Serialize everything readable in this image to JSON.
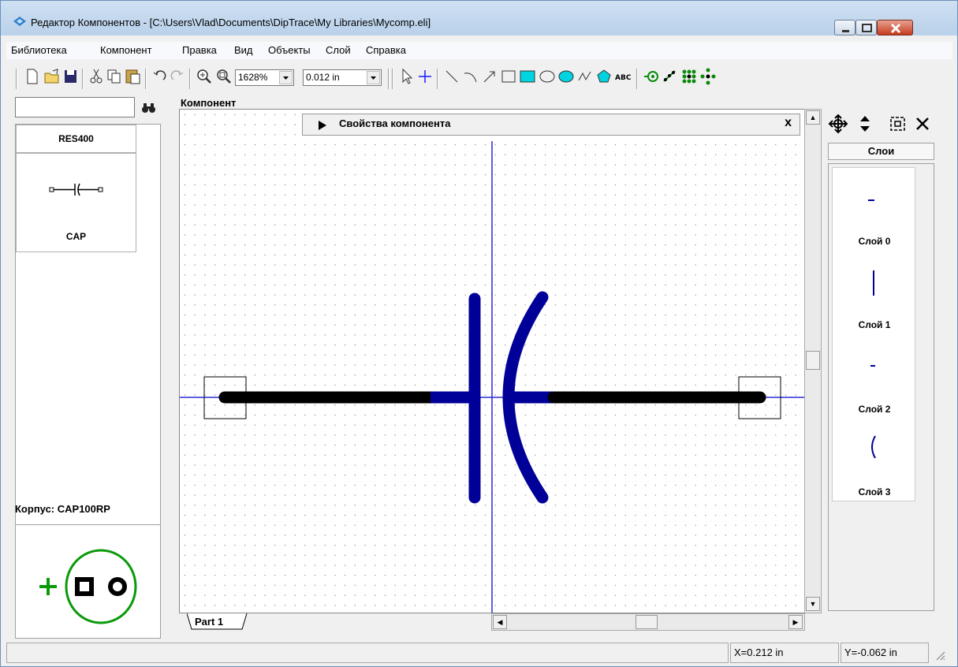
{
  "window": {
    "title": "Редактор Компонентов - [C:\\Users\\Vlad\\Documents\\DipTrace\\My Libraries\\Mycomp.eli]"
  },
  "menu": [
    "Библиотека",
    "Компонент",
    "Правка",
    "Вид",
    "Объекты",
    "Слой",
    "Справка"
  ],
  "toolbar": {
    "zoom": "1628%",
    "grid": "0.012 in"
  },
  "left_panel": {
    "search_value": "",
    "components": [
      {
        "name": "RES400"
      },
      {
        "name": "CAP"
      }
    ],
    "package_label": "Корпус: CAP100RP"
  },
  "canvas": {
    "group_label": "Компонент",
    "properties_bar": "Свойства компонента",
    "properties_close": "x",
    "tab": "Part 1"
  },
  "layers": {
    "header": "Слои",
    "items": [
      {
        "name": "Слой 0"
      },
      {
        "name": "Слой 1"
      },
      {
        "name": "Слой 2"
      },
      {
        "name": "Слой 3"
      }
    ]
  },
  "status": {
    "x": "X=0.212 in",
    "y": "Y=-0.062 in"
  },
  "colors": {
    "wire": "#000000",
    "plate": "#000099",
    "axis": "#2b2bd6",
    "package": "#0a9a0a"
  }
}
